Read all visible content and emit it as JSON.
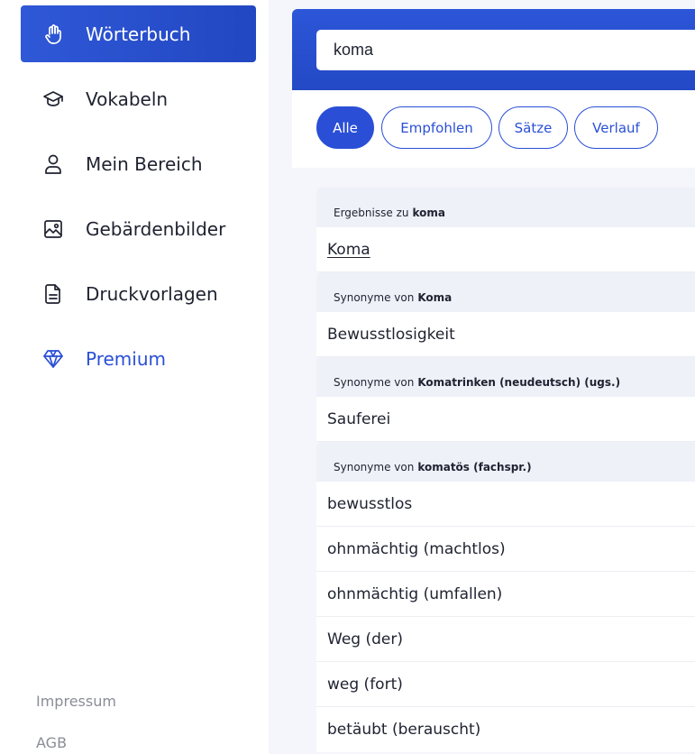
{
  "sidebar": {
    "items": [
      {
        "label": "Wörterbuch",
        "icon": "hand-icon"
      },
      {
        "label": "Vokabeln",
        "icon": "graduation-cap-icon"
      },
      {
        "label": "Mein Bereich",
        "icon": "user-icon"
      },
      {
        "label": "Gebärdenbilder",
        "icon": "image-icon"
      },
      {
        "label": "Druckvorlagen",
        "icon": "document-icon"
      },
      {
        "label": "Premium",
        "icon": "diamond-icon"
      }
    ],
    "footer": {
      "impressum": "Impressum",
      "agb": "AGB"
    }
  },
  "search": {
    "value": "koma"
  },
  "filters": {
    "alle": "Alle",
    "empfohlen": "Empfohlen",
    "saetze": "Sätze",
    "verlauf": "Verlauf"
  },
  "results": {
    "section1": {
      "prefix": "Ergebnisse zu",
      "term": "koma",
      "items": [
        "Koma"
      ]
    },
    "section2": {
      "prefix": "Synonyme von",
      "term": "Koma",
      "items": [
        "Bewusstlosigkeit"
      ]
    },
    "section3": {
      "prefix": "Synonyme von",
      "term": "Komatrinken (neudeutsch) (ugs.)",
      "items": [
        "Sauferei"
      ]
    },
    "section4": {
      "prefix": "Synonyme von",
      "term": "komatös (fachspr.)",
      "items": [
        "bewusstlos",
        "ohnmächtig (machtlos)",
        "ohnmächtig (umfallen)",
        "Weg (der)",
        "weg (fort)",
        "betäubt (berauscht)"
      ]
    }
  },
  "colors": {
    "accent": "#2a4fd6",
    "background": "#f4f6fb",
    "muted": "#8a8d96"
  }
}
